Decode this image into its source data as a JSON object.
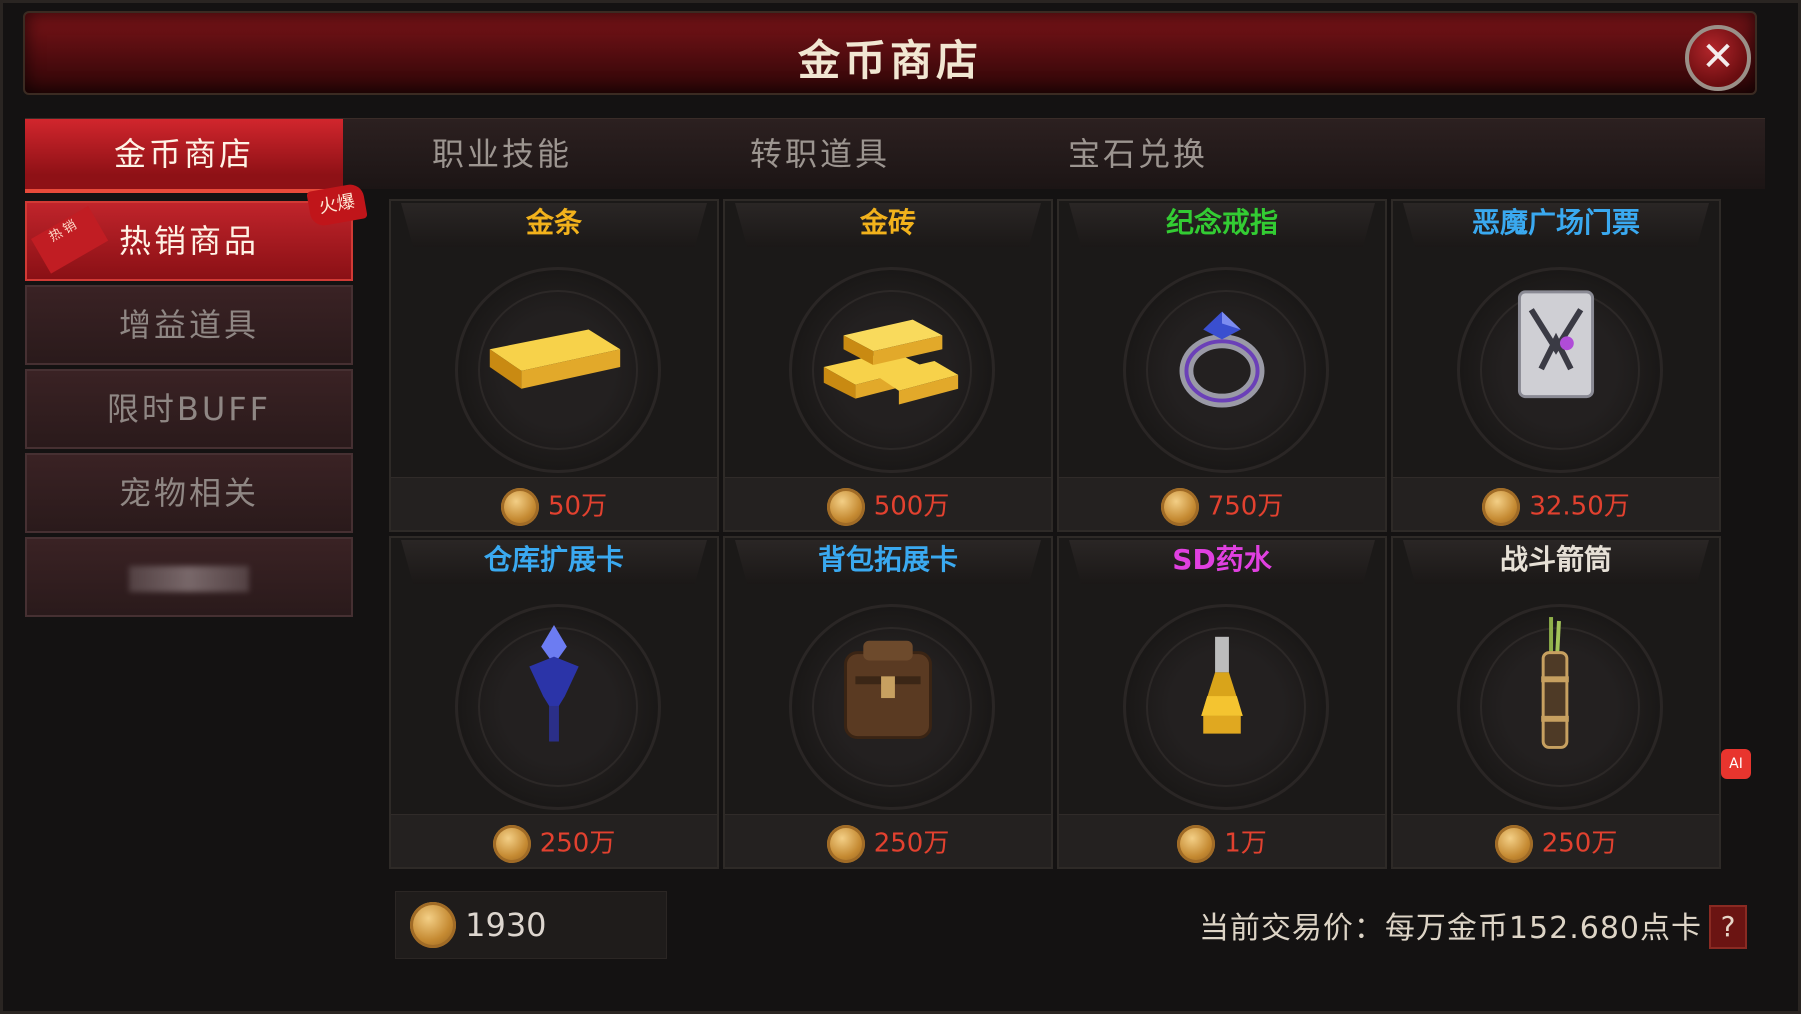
{
  "window": {
    "title": "金币商店",
    "close_icon": "close-icon"
  },
  "tabs": [
    {
      "label": "金币商店",
      "active": true
    },
    {
      "label": "职业技能",
      "active": false
    },
    {
      "label": "转职道具",
      "active": false
    },
    {
      "label": "宝石兑换",
      "active": false
    }
  ],
  "sidebar": {
    "items": [
      {
        "label": "热销商品",
        "active": true,
        "corner_tag": "热销",
        "hot_tag": "火爆"
      },
      {
        "label": "增益道具",
        "active": false
      },
      {
        "label": "限时BUFF",
        "active": false
      },
      {
        "label": "宠物相关",
        "active": false
      },
      {
        "label": "",
        "active": false
      }
    ]
  },
  "items": [
    {
      "name": "金条",
      "price": "50万",
      "name_color": "#f2b21c",
      "icon": "gold-bar-icon"
    },
    {
      "name": "金砖",
      "price": "500万",
      "name_color": "#f2b21c",
      "icon": "gold-bricks-icon"
    },
    {
      "name": "纪念戒指",
      "price": "750万",
      "name_color": "#33cc33",
      "icon": "ring-icon"
    },
    {
      "name": "恶魔广场门票",
      "price": "32.50万",
      "name_color": "#3aa9f0",
      "icon": "ticket-icon"
    },
    {
      "name": "仓库扩展卡",
      "price": "250万",
      "name_color": "#3aa9f0",
      "icon": "crystal-staff-icon"
    },
    {
      "name": "背包拓展卡",
      "price": "250万",
      "name_color": "#3aa9f0",
      "icon": "backpack-icon"
    },
    {
      "name": "SD药水",
      "price": "1万",
      "name_color": "#e040e0",
      "icon": "potion-icon"
    },
    {
      "name": "战斗箭筒",
      "price": "250万",
      "name_color": "#e6e0d6",
      "icon": "quiver-icon"
    }
  ],
  "footer": {
    "balance": "1930",
    "rate_text": "当前交易价：每万金币152.680点卡",
    "help_label": "?",
    "ai_badge": "AI"
  }
}
